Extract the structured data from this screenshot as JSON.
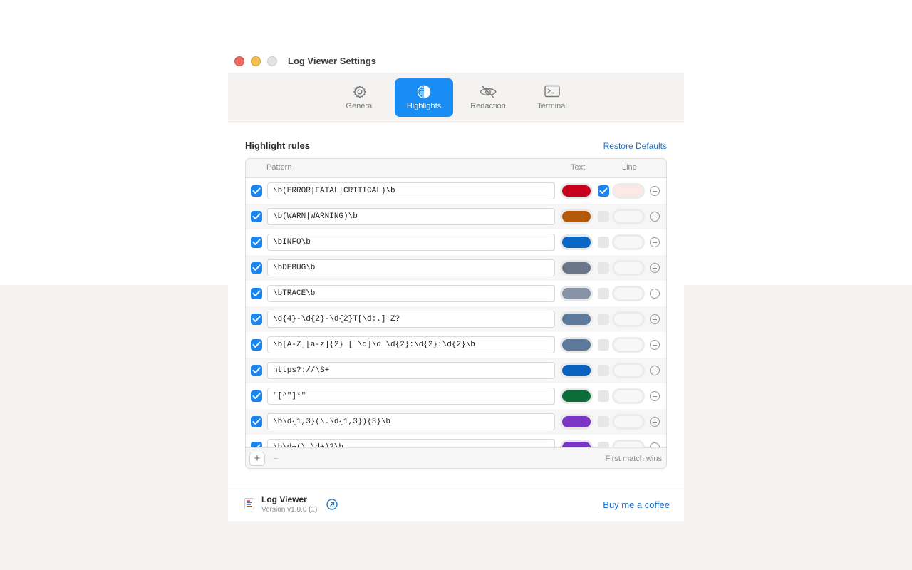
{
  "window": {
    "title": "Log Viewer Settings"
  },
  "tabs": [
    {
      "label": "General",
      "icon": "gear-icon",
      "active": false
    },
    {
      "label": "Highlights",
      "icon": "circle-half-icon",
      "active": true
    },
    {
      "label": "Redaction",
      "icon": "eye-slash-icon",
      "active": false
    },
    {
      "label": "Terminal",
      "icon": "terminal-icon",
      "active": false
    }
  ],
  "highlights": {
    "title": "Highlight rules",
    "restore_label": "Restore Defaults",
    "columns": {
      "pattern": "Pattern",
      "text": "Text",
      "line": "Line"
    },
    "rules": [
      {
        "enabled": true,
        "pattern": "\\b(ERROR|FATAL|CRITICAL)\\b",
        "text_color": "#c8001e",
        "line_enabled": true,
        "line_color": "#fde8e8"
      },
      {
        "enabled": true,
        "pattern": "\\b(WARN|WARNING)\\b",
        "text_color": "#b4580a",
        "line_enabled": false,
        "line_color": "#f7f7f7"
      },
      {
        "enabled": true,
        "pattern": "\\bINFO\\b",
        "text_color": "#0a66c2",
        "line_enabled": false,
        "line_color": "#f7f7f7"
      },
      {
        "enabled": true,
        "pattern": "\\bDEBUG\\b",
        "text_color": "#6b7789",
        "line_enabled": false,
        "line_color": "#f7f7f7"
      },
      {
        "enabled": true,
        "pattern": "\\bTRACE\\b",
        "text_color": "#8794a6",
        "line_enabled": false,
        "line_color": "#f7f7f7"
      },
      {
        "enabled": true,
        "pattern": "\\d{4}-\\d{2}-\\d{2}T[\\d:.]+Z?",
        "text_color": "#5d7a9c",
        "line_enabled": false,
        "line_color": "#f7f7f7"
      },
      {
        "enabled": true,
        "pattern": "\\b[A-Z][a-z]{2} [ \\d]\\d \\d{2}:\\d{2}:\\d{2}\\b",
        "text_color": "#5d7a9c",
        "line_enabled": false,
        "line_color": "#f7f7f7"
      },
      {
        "enabled": true,
        "pattern": "https?://\\S+",
        "text_color": "#0a62c0",
        "line_enabled": false,
        "line_color": "#f7f7f7"
      },
      {
        "enabled": true,
        "pattern": "\"[^\"]*\"",
        "text_color": "#0b6e3a",
        "line_enabled": false,
        "line_color": "#f7f7f7"
      },
      {
        "enabled": true,
        "pattern": "\\b\\d{1,3}(\\.\\d{1,3}){3}\\b",
        "text_color": "#7a35c4",
        "line_enabled": false,
        "line_color": "#f7f7f7"
      },
      {
        "enabled": true,
        "pattern": "\\b\\d+(\\.\\d+)?\\b",
        "text_color": "#7a35c4",
        "line_enabled": false,
        "line_color": "#f7f7f7"
      }
    ],
    "footer_note": "First match wins",
    "add_label": "+",
    "remove_label": "−"
  },
  "about": {
    "app_name": "Log Viewer",
    "version": "Version v1.0.0 (1)",
    "coffee_label": "Buy me a coffee"
  }
}
